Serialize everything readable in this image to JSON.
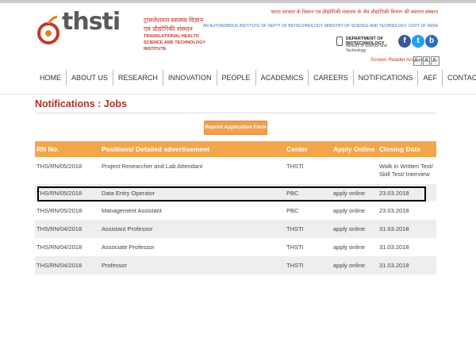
{
  "logo": {
    "wordmark": "thsti",
    "hindi_name": "ट्रांसलेशनल स्वास्थ्य विज्ञान एवं प्रौद्योगिकी संस्थान",
    "english_name": "TRANSLATIONAL HEALTH SCIENCE AND TECHNOLOGY INSTITUTE"
  },
  "header": {
    "hindi_line": "भारत सरकार के विज्ञान एवं प्रौद्योगिकी मंत्रालय के जैव प्रौद्योगिकी विभाग की स्वायत्त संस्थान",
    "english_line": "AN AUTONOMOUS INSTITUTE OF DEPTT OF BIOTECHNOLOGY, MINISTRY OF SCIENCE AND TECHNOLOGY, GOVT OF INDIA",
    "dbt_line1": "DEPARTMENT OF BIOTECHNOLOGY",
    "dbt_line2": "Ministry of Science and Technology",
    "social": {
      "fb": "f",
      "tw": "t",
      "blog": "b"
    },
    "screen_reader": "Screen Reader Access",
    "font_sizes": [
      "A+",
      "A",
      "A-"
    ]
  },
  "nav": [
    "HOME",
    "ABOUT US",
    "RESEARCH",
    "INNOVATION",
    "PEOPLE",
    "ACADEMICS",
    "CAREERS",
    "NOTIFICATIONS",
    "AEF",
    "CONTACT US"
  ],
  "page": {
    "title": "Notifications : Jobs",
    "reprint_button": "Reprint Application Form"
  },
  "table": {
    "headers": [
      "RN No.",
      "Positions/ Detailed advertisement",
      "Center",
      "Apply Online",
      "Closing Date"
    ],
    "rows": [
      [
        "THS/RN/05/2018",
        "Project Researcher and Lab Attendant",
        "THSTI",
        "",
        "Walk in Written Test/ Skill Test/ Interview"
      ],
      [
        "THS/RN/05/2018",
        "Data Entry Operator",
        "PBC",
        "apply online",
        "23.03.2018"
      ],
      [
        "THS/RN/05/2018",
        "Management Assistant",
        "PBC",
        "apply online",
        "23.03.2018"
      ],
      [
        "THS/RN/04/2018",
        "Assistant Professor",
        "THSTI",
        "apply online",
        "31.03.2018"
      ],
      [
        "THS/RN/04/2018",
        "Associate Professor",
        "THSTI",
        "apply online",
        "31.03.2018"
      ],
      [
        "THS/RN/04/2018",
        "Professor",
        "THSTI",
        "apply online",
        "31.03.2018"
      ]
    ]
  },
  "colors": {
    "accent_red": "#a8322a",
    "table_header": "#f2a54a",
    "button": "#f0a050"
  }
}
